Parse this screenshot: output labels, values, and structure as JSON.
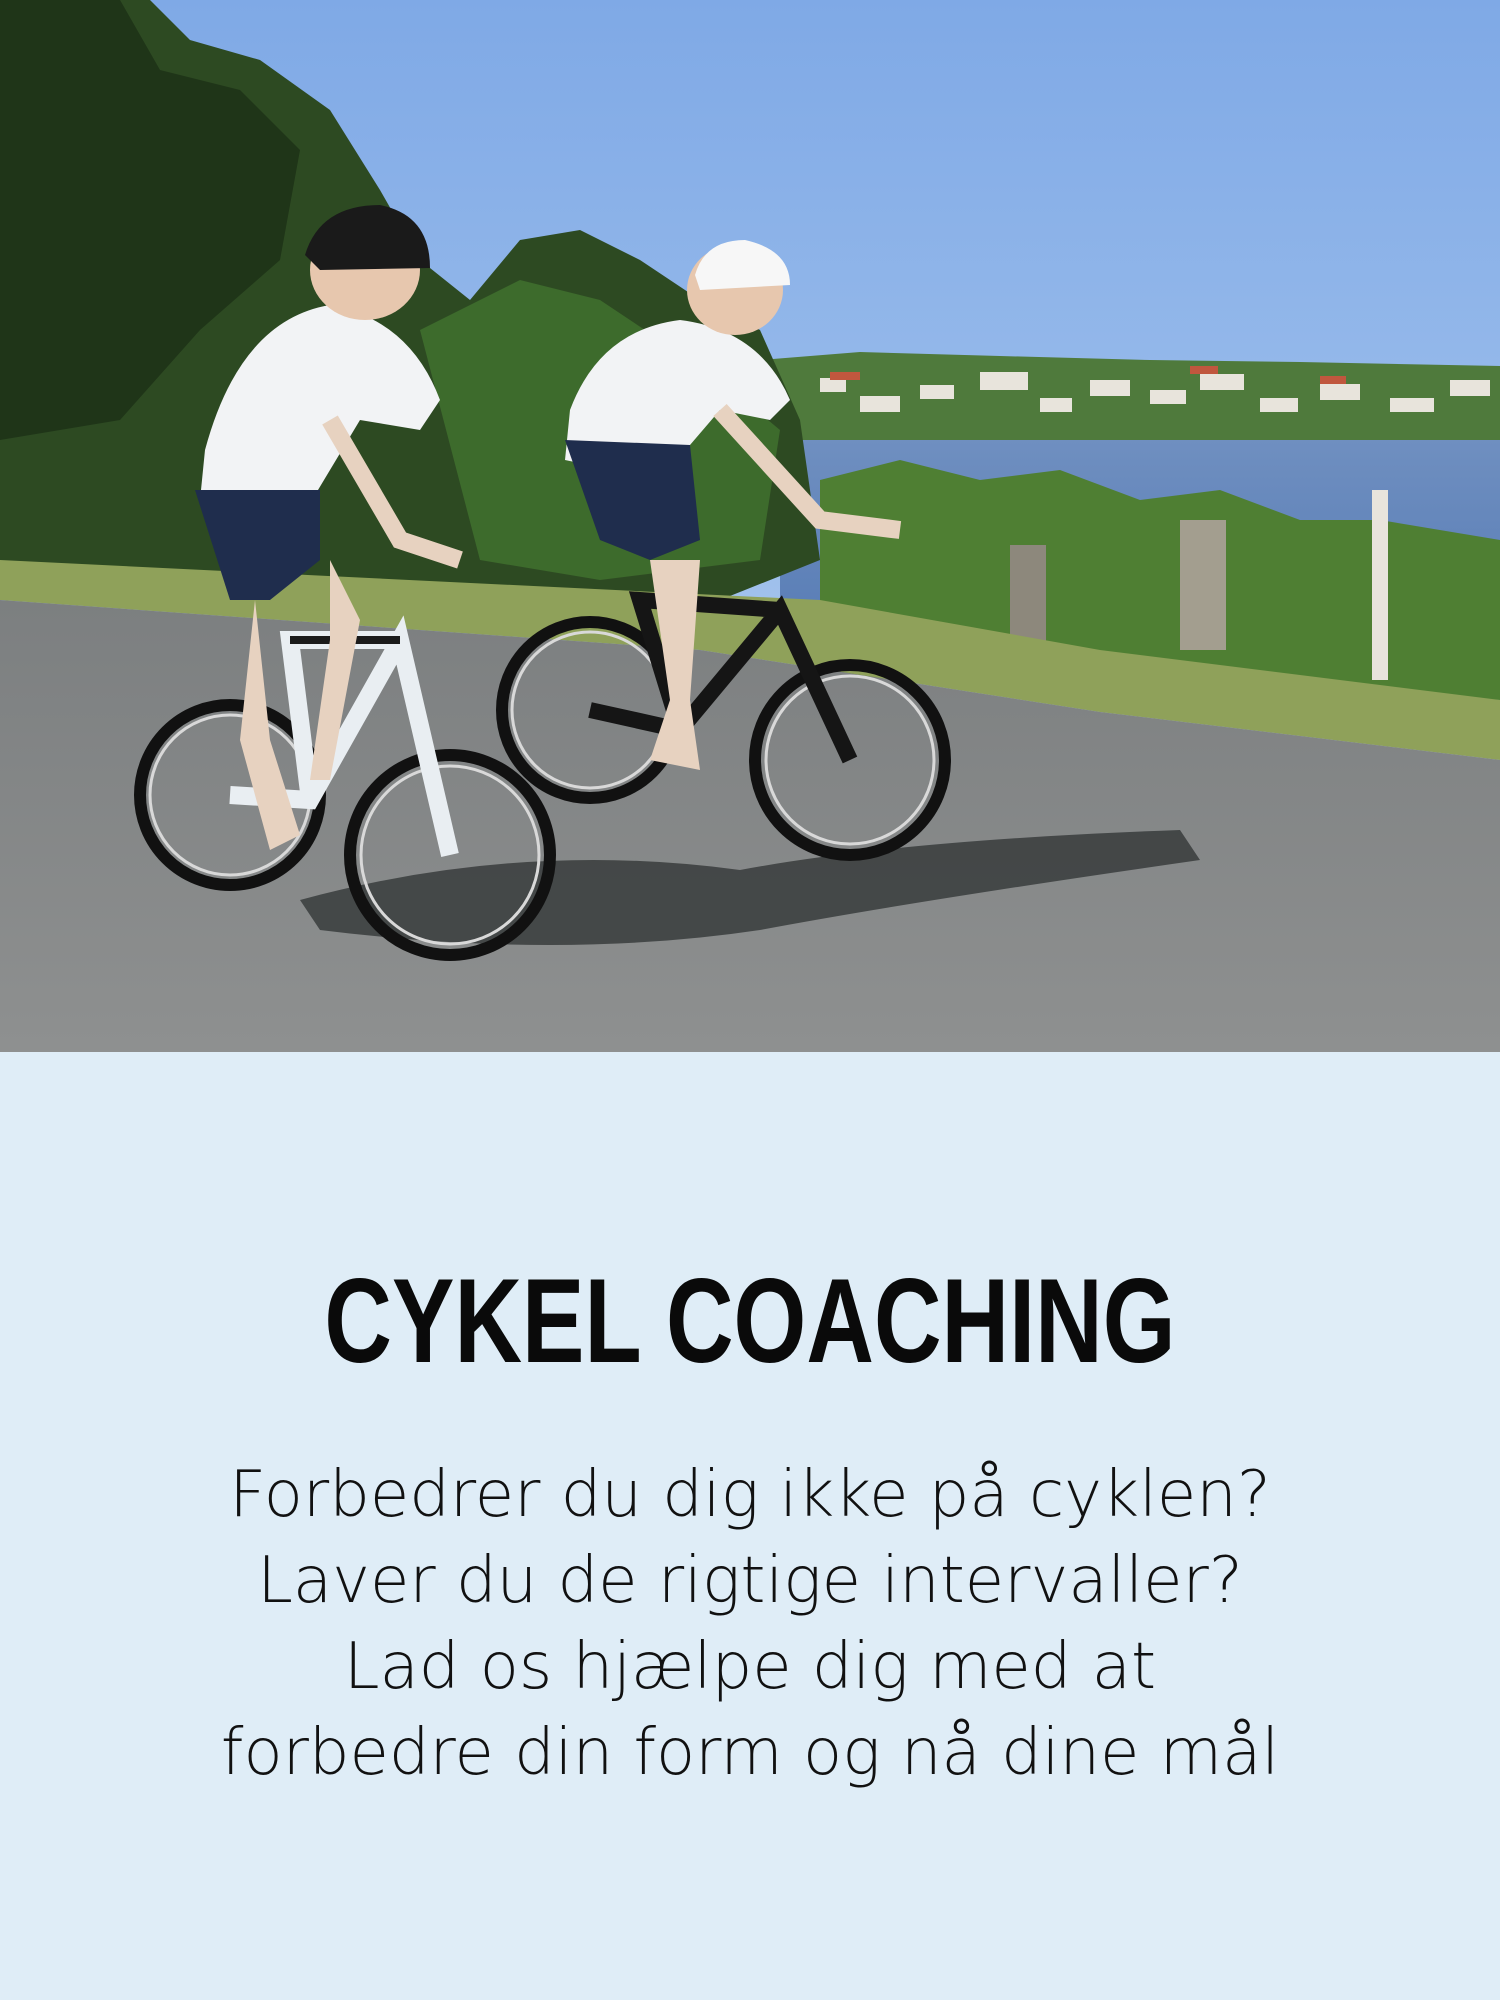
{
  "hero": {
    "image_icon": "cyclists-photo"
  },
  "card": {
    "title": "CYKEL COACHING",
    "lines": [
      "Forbedrer du dig ikke på cyklen?",
      "Laver du de rigtige intervaller?",
      "Lad os hjælpe dig med at",
      "forbedre din form og nå dine mål"
    ]
  },
  "colors": {
    "panel_bg": "#dfedf7",
    "title": "#0a0a0a",
    "text": "#111111"
  }
}
